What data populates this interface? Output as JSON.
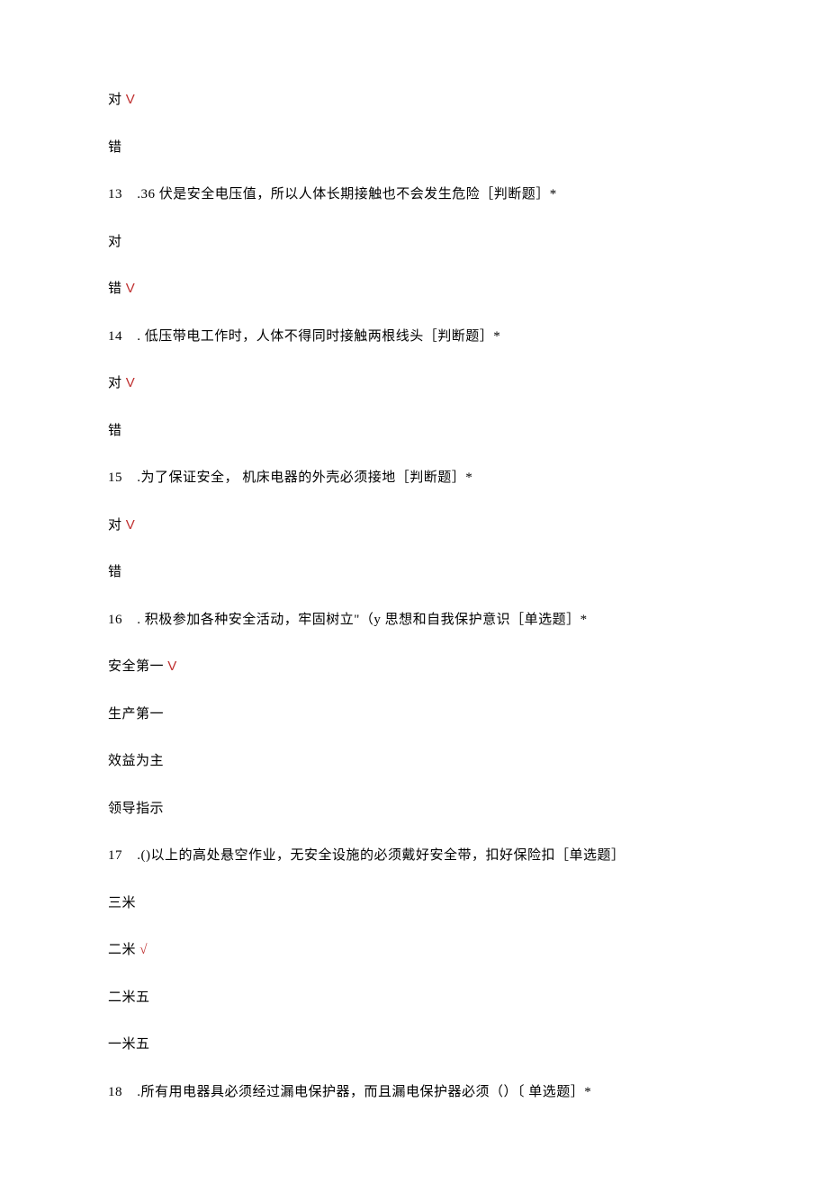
{
  "lines": {
    "q12_opt_true": "对 ",
    "q12_opt_true_mark": "V",
    "q12_opt_false": "错",
    "q13_num": "13",
    "q13_text": "  .36 伏是安全电压值，所以人体长期接触也不会发生危险［判断题］*",
    "q13_opt_true": "对",
    "q13_opt_false": "错 ",
    "q13_opt_false_mark": "V",
    "q14_num": "14",
    "q14_text": "  . 低压带电工作时，人体不得同时接触两根线头［判断题］*",
    "q14_opt_true": "对 ",
    "q14_opt_true_mark": "V",
    "q14_opt_false": "错",
    "q15_num": "15",
    "q15_text": "  .为了保证安全， 机床电器的外壳必须接地［判断题］*",
    "q15_opt_true": "对 ",
    "q15_opt_true_mark": "V",
    "q15_opt_false": "错",
    "q16_num": "16",
    "q16_text": "  . 积极参加各种安全活动，牢固树立\"（y 思想和自我保护意识［单选题］*",
    "q16_opt_a": "安全第一 ",
    "q16_opt_a_mark": "V",
    "q16_opt_b": "生产第一",
    "q16_opt_c": "效益为主",
    "q16_opt_d": "领导指示",
    "q17_num": "17",
    "q17_text": "  .()以上的高处悬空作业，无安全设施的必须戴好安全带，扣好保险扣［单选题］",
    "q17_opt_a": "三米",
    "q17_opt_b": "二米 ",
    "q17_opt_b_mark": "√",
    "q17_opt_c": "二米五",
    "q17_opt_d": "一米五",
    "q18_num": "18",
    "q18_text": "  .所有用电器具必须经过漏电保护器，而且漏电保护器必须（）〔 单选题］*"
  }
}
